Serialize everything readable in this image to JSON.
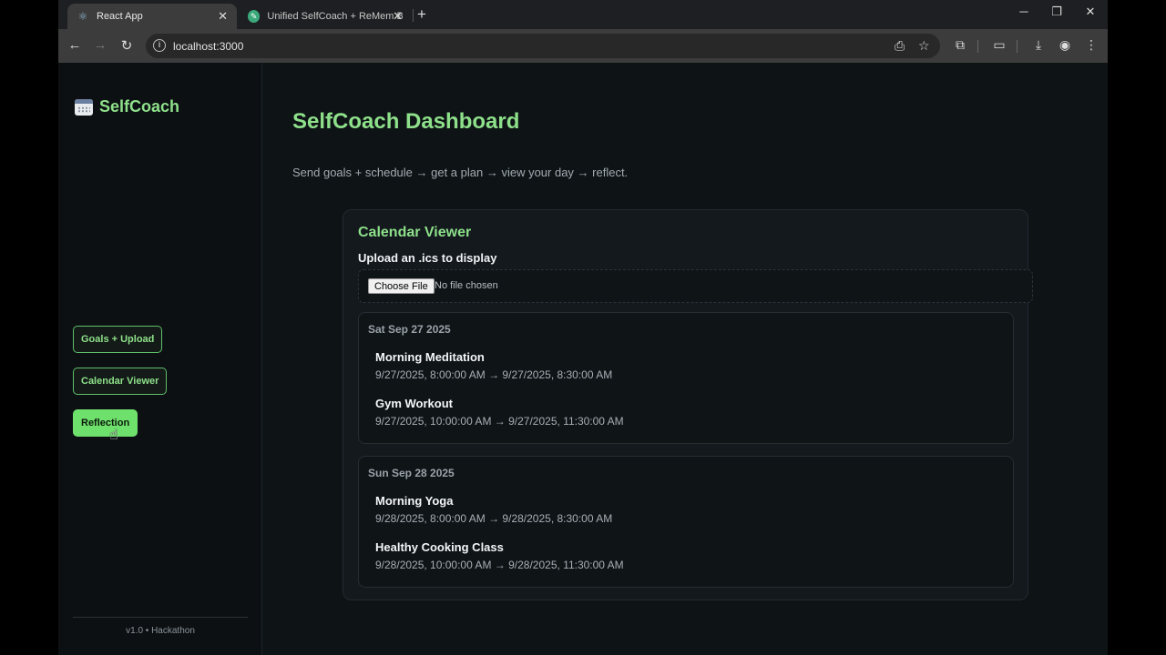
{
  "browser": {
    "tabs": [
      {
        "title": "React App",
        "icon": "react-icon",
        "active": true
      },
      {
        "title": "Unified SelfCoach + ReMem Ba",
        "icon": "feather-icon",
        "active": false
      }
    ],
    "url": "localhost:3000"
  },
  "sidebar": {
    "brand": "SelfCoach",
    "nav": [
      {
        "label": "Goals + Upload",
        "active": false
      },
      {
        "label": "Calendar Viewer",
        "active": false
      },
      {
        "label": "Reflection",
        "active": true
      }
    ],
    "footer": "v1.0 • Hackathon"
  },
  "main": {
    "title": "SelfCoach Dashboard",
    "subtitle": "Send goals + schedule → get a plan → view your day → reflect."
  },
  "calendar": {
    "title": "Calendar Viewer",
    "upload_label": "Upload an .ics to display",
    "choose_button": "Choose File",
    "file_status": "No file chosen",
    "days": [
      {
        "date": "Sat Sep 27 2025",
        "events": [
          {
            "title": "Morning Meditation",
            "time": "9/27/2025, 8:00:00 AM → 9/27/2025, 8:30:00 AM"
          },
          {
            "title": "Gym Workout",
            "time": "9/27/2025, 10:00:00 AM → 9/27/2025, 11:30:00 AM"
          }
        ]
      },
      {
        "date": "Sun Sep 28 2025",
        "events": [
          {
            "title": "Morning Yoga",
            "time": "9/28/2025, 8:00:00 AM → 9/28/2025, 8:30:00 AM"
          },
          {
            "title": "Healthy Cooking Class",
            "time": "9/28/2025, 10:00:00 AM → 9/28/2025, 11:30:00 AM"
          }
        ]
      }
    ]
  },
  "colors": {
    "accent": "#8ee08a",
    "active_button": "#6ee06c",
    "background": "#0e1316"
  }
}
